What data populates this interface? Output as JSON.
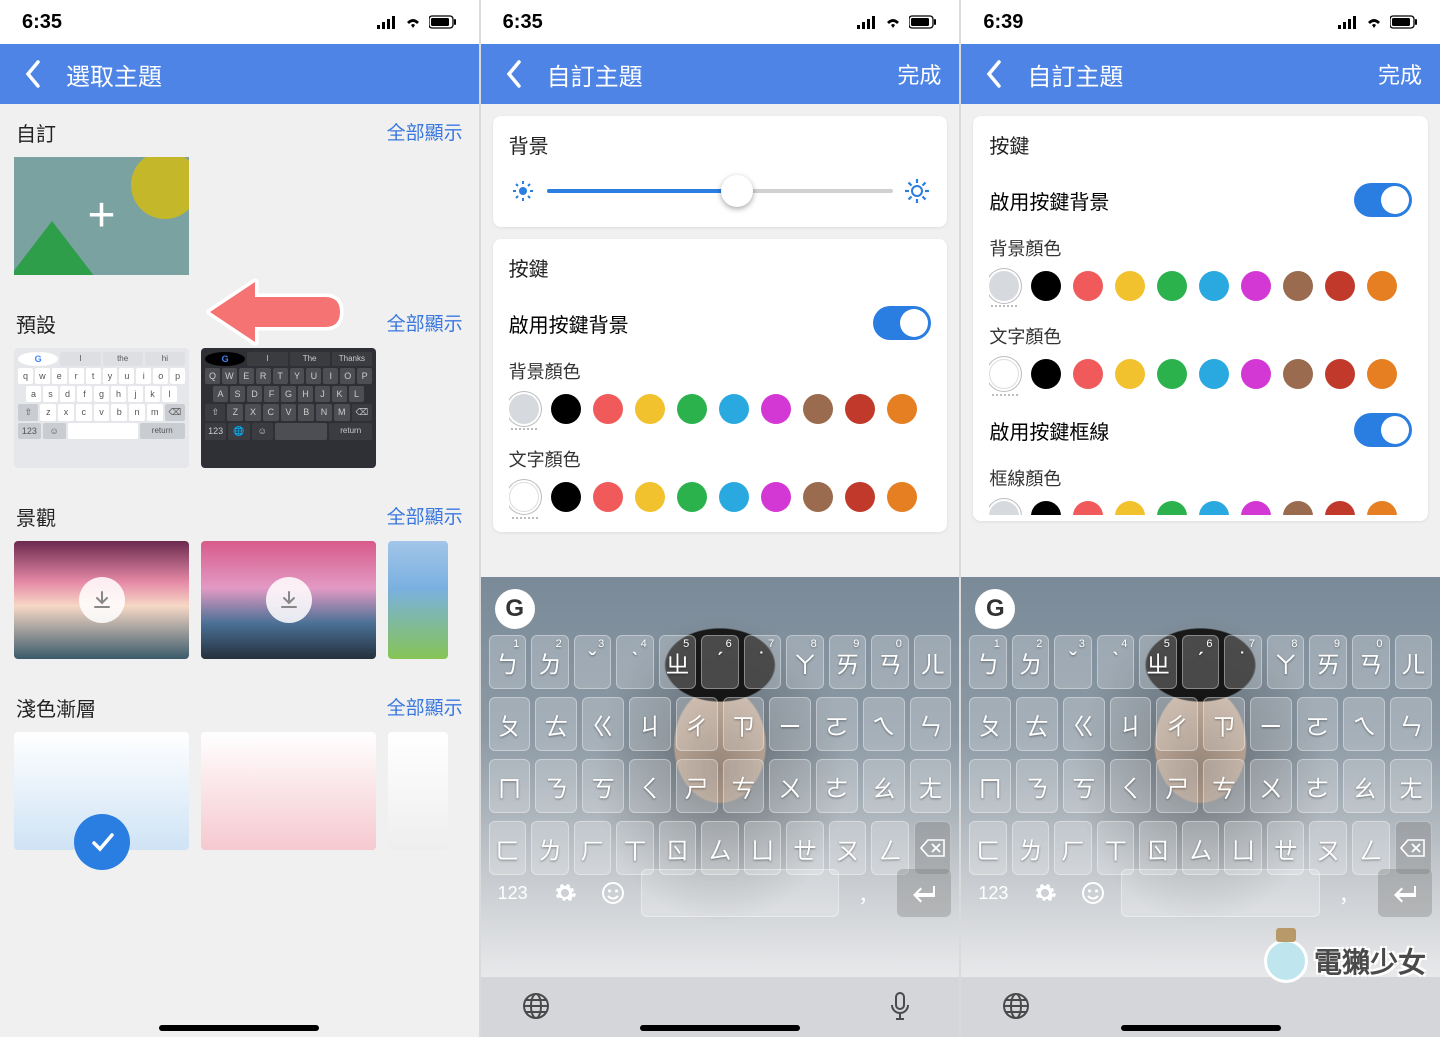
{
  "status": {
    "time_a": "6:35",
    "time_b": "6:35",
    "time_c": "6:39"
  },
  "screen1": {
    "header_title": "選取主題",
    "section_custom": "自訂",
    "section_preset": "預設",
    "section_landscape": "景觀",
    "section_light_gradient": "淺色漸層",
    "show_all": "全部顯示",
    "kb_light_suggestions": [
      "I",
      "the",
      "hi"
    ],
    "kb_dark_suggestions": [
      "I",
      "The",
      "Thanks"
    ],
    "g_label": "G",
    "n123": "123",
    "return_label": "return"
  },
  "screen2": {
    "header_title": "自訂主題",
    "done": "完成",
    "panel_bg": "背景",
    "panel_keys": "按鍵",
    "enable_key_bg": "啟用按鍵背景",
    "bg_color": "背景顏色",
    "text_color": "文字顏色",
    "slider_pct": 55,
    "n123": "123",
    "comma": "，"
  },
  "screen3": {
    "header_title": "自訂主題",
    "done": "完成",
    "panel_keys": "按鍵",
    "enable_key_bg": "啟用按鍵背景",
    "bg_color": "背景顏色",
    "text_color": "文字顏色",
    "enable_key_border": "啟用按鍵框線",
    "border_color": "框線顏色",
    "n123": "123",
    "comma": "，"
  },
  "colors": {
    "swatches_bg": [
      "#d6d9de",
      "#000000",
      "#f05a5a",
      "#f2c22e",
      "#2bb24c",
      "#2aa9e0",
      "#d438d4",
      "#9a6b4f",
      "#c0392b",
      "#e67e22"
    ],
    "swatches_text": [
      "#ffffff",
      "#000000",
      "#f05a5a",
      "#f2c22e",
      "#2bb24c",
      "#2aa9e0",
      "#d438d4",
      "#9a6b4f",
      "#c0392b",
      "#e67e22"
    ]
  },
  "zhuyin": {
    "r1": [
      "ㄅ",
      "ㄉ",
      "ˇ",
      "ˋ",
      "ㄓ",
      "ˊ",
      "˙",
      "ㄚ",
      "ㄞ",
      "ㄢ",
      "ㄦ"
    ],
    "r1n": [
      "1",
      "2",
      "3",
      "4",
      "5",
      "6",
      "7",
      "8",
      "9",
      "0",
      ""
    ],
    "r2": [
      "ㄆ",
      "ㄊ",
      "ㄍ",
      "ㄐ",
      "ㄔ",
      "ㄗ",
      "ㄧ",
      "ㄛ",
      "ㄟ",
      "ㄣ"
    ],
    "r3": [
      "ㄇ",
      "ㄋ",
      "ㄎ",
      "ㄑ",
      "ㄕ",
      "ㄘ",
      "ㄨ",
      "ㄜ",
      "ㄠ",
      "ㄤ"
    ],
    "r4": [
      "ㄈ",
      "ㄌ",
      "ㄏ",
      "ㄒ",
      "ㄖ",
      "ㄙ",
      "ㄩ",
      "ㄝ",
      "ㄡ",
      "ㄥ"
    ]
  },
  "watermark": "電獺少女"
}
